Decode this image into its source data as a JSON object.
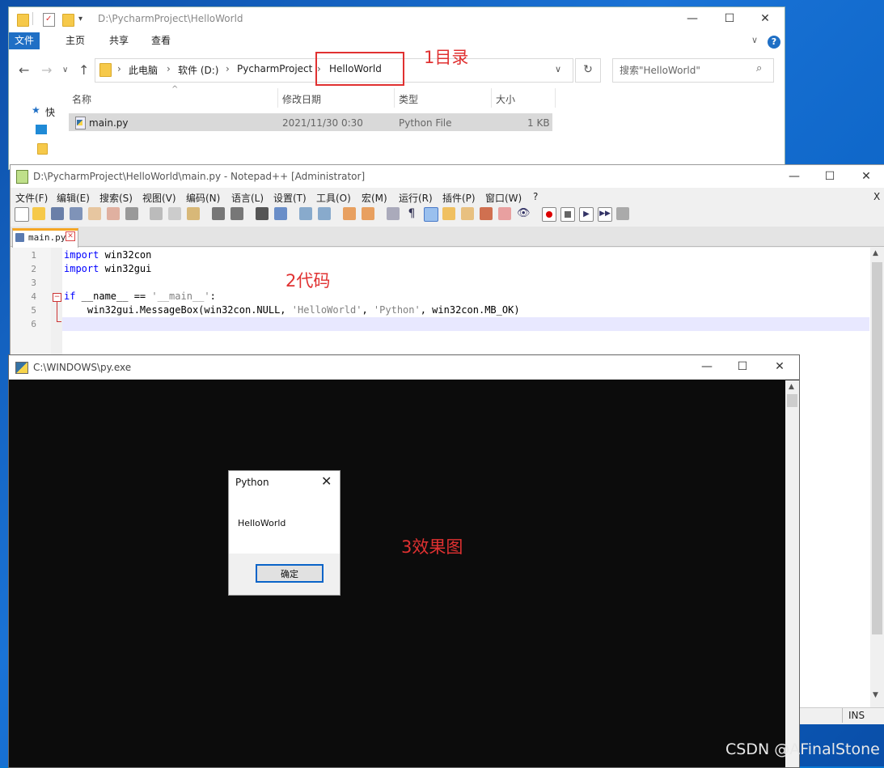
{
  "explorer": {
    "title": "D:\\PycharmProject\\HelloWorld",
    "ribbon_tabs": [
      "文件",
      "主页",
      "共享",
      "查看"
    ],
    "breadcrumb": [
      "此电脑",
      "软件 (D:)",
      "PycharmProject",
      "HelloWorld"
    ],
    "search_placeholder": "搜索\"HelloWorld\"",
    "columns": [
      "名称",
      "修改日期",
      "类型",
      "大小"
    ],
    "files": [
      {
        "name": "main.py",
        "modified": "2021/11/30 0:30",
        "type": "Python File",
        "size": "1 KB"
      }
    ],
    "left_pane_quick": "快"
  },
  "annotations": {
    "a1": "1目录",
    "a2": "2代码",
    "a3": "3效果图"
  },
  "notepad": {
    "title": "D:\\PycharmProject\\HelloWorld\\main.py - Notepad++ [Administrator]",
    "menu": [
      "文件(F)",
      "编辑(E)",
      "搜索(S)",
      "视图(V)",
      "编码(N)",
      "语言(L)",
      "设置(T)",
      "工具(O)",
      "宏(M)",
      "运行(R)",
      "插件(P)",
      "窗口(W)",
      "?"
    ],
    "menu_close": "X",
    "tab_name": "main.py",
    "line_numbers": [
      "1",
      "2",
      "3",
      "4",
      "5",
      "6"
    ],
    "code": {
      "l1_kw": "import",
      "l1_rest": " win32con",
      "l2_kw": "import",
      "l2_rest": " win32gui",
      "l4_kw": "if",
      "l4_a": " __name__ == ",
      "l4_str": "'__main__'",
      "l4_b": ":",
      "l5_a": "    win32gui.MessageBox(win32con.NULL, ",
      "l5_s1": "'HelloWorld'",
      "l5_b": ", ",
      "l5_s2": "'Python'",
      "l5_c": ", win32con.MB_OK)"
    },
    "status_ins": "INS"
  },
  "console": {
    "title": "C:\\WINDOWS\\py.exe"
  },
  "messagebox": {
    "title": "Python",
    "text": "HelloWorld",
    "ok_label": "确定"
  },
  "watermark": "CSDN @AFinalStone",
  "colors": {
    "accent": "#1f6fc5",
    "annotation_red": "#e03131",
    "keyword_blue": "#0000ff",
    "console_bg": "#0c0c0c"
  }
}
